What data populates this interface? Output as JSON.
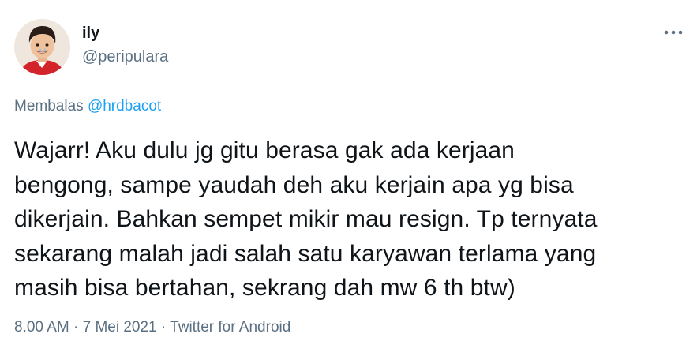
{
  "author": {
    "name": "ily",
    "handle": "@peripulara",
    "avatar_icon": "profile-photo-child-in-red"
  },
  "more_icon": "more-horizontal-icon",
  "reply": {
    "prefix": "Membalas",
    "mention": "@hrdbacot"
  },
  "tweet": {
    "lines": [
      "Wajarr! Aku dulu jg gitu berasa gak ada kerjaan",
      "bengong, sampe yaudah deh aku kerjain apa yg bisa",
      "dikerjain. Bahkan sempet mikir mau resign. Tp ternyata",
      "sekarang malah jadi salah satu karyawan terlama yang",
      "masih bisa bertahan, sekrang dah mw 6 th btw)"
    ]
  },
  "meta": {
    "time": "8.00 AM",
    "separator": "·",
    "date": "7 Mei 2021",
    "source": "Twitter for Android"
  },
  "colors": {
    "text": "#0f1419",
    "secondary": "#5b7083",
    "link": "#1da1f2",
    "divider": "#e6ecf0"
  }
}
